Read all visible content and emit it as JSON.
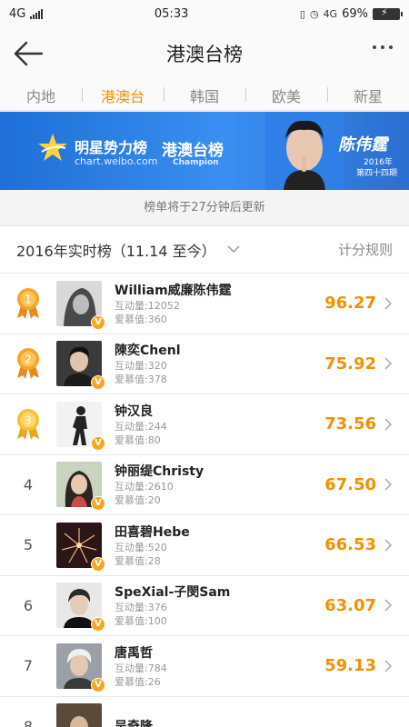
{
  "status_bar": {
    "network": "4G",
    "time": "05:33",
    "network_right": "4G",
    "battery": "69%"
  },
  "header": {
    "title": "港澳台榜"
  },
  "tabs": [
    {
      "label": "内地",
      "active": false
    },
    {
      "label": "港澳台",
      "active": true
    },
    {
      "label": "韩国",
      "active": false
    },
    {
      "label": "欧美",
      "active": false
    },
    {
      "label": "新星",
      "active": false
    }
  ],
  "banner": {
    "brand": "明星势力榜",
    "url": "chart.weibo.com",
    "board": "港澳台榜",
    "board_en": "Champion",
    "star_name": "陈伟霆",
    "year": "2016年",
    "period": "第四十四期"
  },
  "update_note": "榜单将于27分钟后更新",
  "filter": {
    "label": "2016年实时榜（11.14 至今）",
    "rules_link": "计分规则"
  },
  "labels": {
    "interaction": "互动量:",
    "fan_value": "爱慕值:",
    "verified": "V"
  },
  "colors": {
    "accent": "#f29100",
    "banner_blue": "#2f7fe6",
    "medal_gold": "#f5a623"
  },
  "rankings": [
    {
      "rank": "1",
      "name": "William威廉陈伟霆",
      "interaction": "12052",
      "fan_value": "360",
      "score": "96.27",
      "medal": true
    },
    {
      "rank": "2",
      "name": "陳奕Chenl",
      "interaction": "320",
      "fan_value": "378",
      "score": "75.92",
      "medal": true
    },
    {
      "rank": "3",
      "name": "钟汉良",
      "interaction": "244",
      "fan_value": "80",
      "score": "73.56",
      "medal": true
    },
    {
      "rank": "4",
      "name": "钟丽缇Christy",
      "interaction": "2610",
      "fan_value": "20",
      "score": "67.50",
      "medal": false
    },
    {
      "rank": "5",
      "name": "田喜碧Hebe",
      "interaction": "520",
      "fan_value": "28",
      "score": "66.53",
      "medal": false
    },
    {
      "rank": "6",
      "name": "SpeXial-子閔Sam",
      "interaction": "376",
      "fan_value": "100",
      "score": "63.07",
      "medal": false
    },
    {
      "rank": "7",
      "name": "唐禹哲",
      "interaction": "784",
      "fan_value": "26",
      "score": "59.13",
      "medal": false
    },
    {
      "rank": "8",
      "name": "吴奇隆",
      "interaction": "",
      "fan_value": "",
      "score": "",
      "medal": false
    }
  ]
}
